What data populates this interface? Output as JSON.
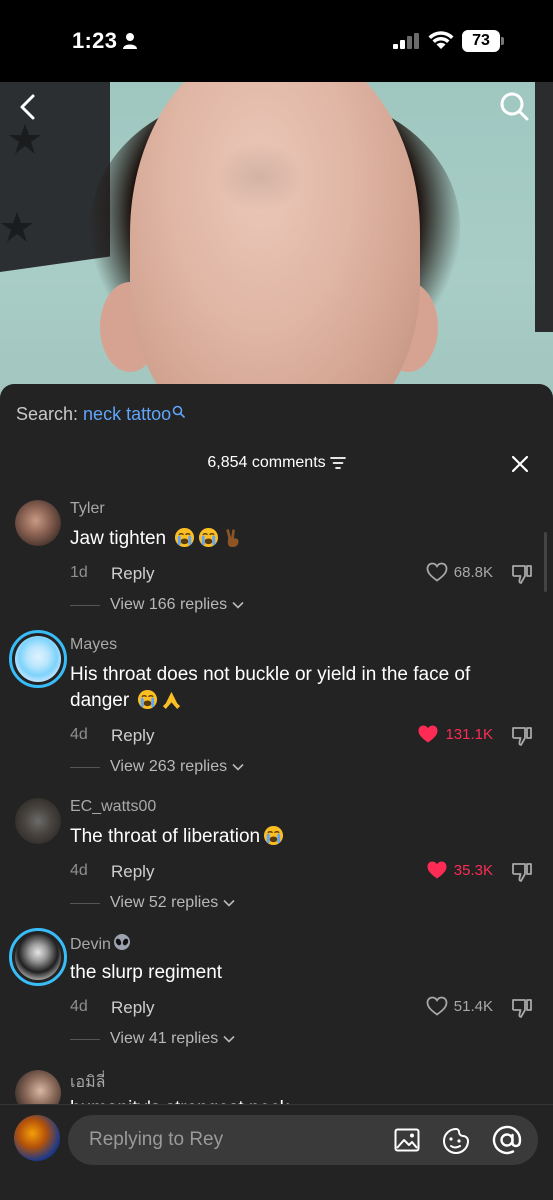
{
  "status_bar": {
    "time": "1:23",
    "battery": "73"
  },
  "video": {
    "icons": [
      "back-icon",
      "search-icon"
    ]
  },
  "sheet": {
    "search_label": "Search: ",
    "search_term": "neck tattoo",
    "comment_count": "6,854 comments"
  },
  "comments": [
    {
      "username": "Tyler",
      "text": "Jaw tighten",
      "emojis": [
        "loudly-crying-face",
        "loudly-crying-face",
        "victory-hand"
      ],
      "age": "1d",
      "reply_label": "Reply",
      "likes": "68.8K",
      "liked": false,
      "view_replies": "View 166 replies"
    },
    {
      "username": "Mayes",
      "text": "His throat does not buckle or yield in the face of danger",
      "emojis": [
        "loudly-crying-face",
        "folded-hands"
      ],
      "age": "4d",
      "reply_label": "Reply",
      "likes": "131.1K",
      "liked": true,
      "view_replies": "View 263 replies"
    },
    {
      "username": "EC_watts00",
      "text": "The throat of liberation",
      "emojis": [
        "loudly-crying-face"
      ],
      "age": "4d",
      "reply_label": "Reply",
      "likes": "35.3K",
      "liked": true,
      "view_replies": "View 52 replies"
    },
    {
      "username": "Devin",
      "text": "the slurp regiment",
      "emojis": [],
      "age": "4d",
      "reply_label": "Reply",
      "likes": "51.4K",
      "liked": false,
      "view_replies": "View 41 replies"
    },
    {
      "username": "เอมิลี่",
      "text": "humanity's strongest neck"
    }
  ],
  "input": {
    "placeholder": "Replying to Rey"
  },
  "colors": {
    "accent_blue": "#60a5fa",
    "like_red": "#fe2c55",
    "story_ring": "#38bdf8",
    "sheet_bg": "#232323"
  }
}
